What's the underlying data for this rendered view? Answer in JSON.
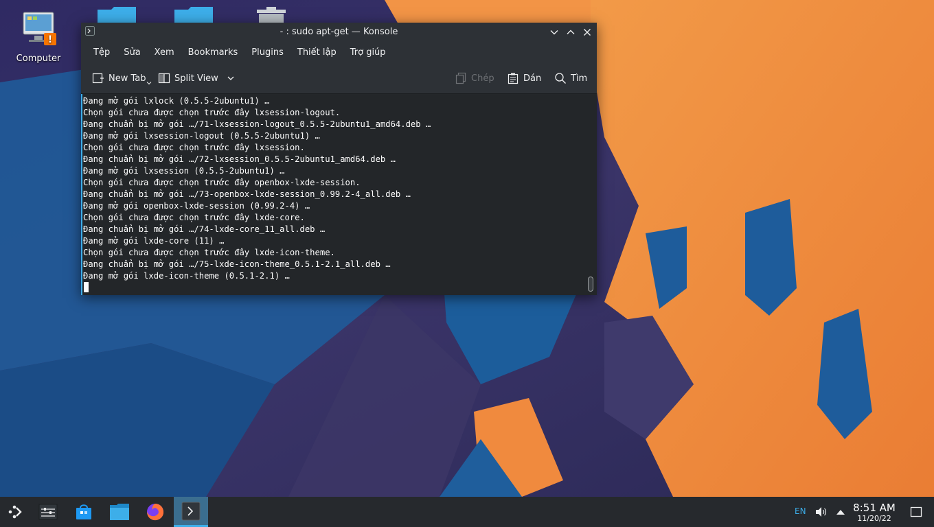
{
  "desktop": {
    "icons": [
      {
        "label": "Computer",
        "icon": "computer-icon"
      },
      {
        "label": "",
        "icon": "folder-icon"
      },
      {
        "label": "",
        "icon": "folder-icon"
      },
      {
        "label": "",
        "icon": "trash-icon"
      }
    ]
  },
  "window": {
    "title": "- : sudo apt-get — Konsole",
    "menu": [
      "Tệp",
      "Sửa",
      "Xem",
      "Bookmarks",
      "Plugins",
      "Thiết lập",
      "Trợ giúp"
    ],
    "toolbar": {
      "new_tab": "New Tab",
      "split_view": "Split View",
      "copy": "Chép",
      "paste": "Dán",
      "find": "Tìm"
    }
  },
  "terminal": {
    "lines": [
      "Đang mở gói lxlock (0.5.5-2ubuntu1) …",
      "Chọn gói chưa được chọn trước đây lxsession-logout.",
      "Đang chuẩn bị mở gói …/71-lxsession-logout_0.5.5-2ubuntu1_amd64.deb …",
      "Đang mở gói lxsession-logout (0.5.5-2ubuntu1) …",
      "Chọn gói chưa được chọn trước đây lxsession.",
      "Đang chuẩn bị mở gói …/72-lxsession_0.5.5-2ubuntu1_amd64.deb …",
      "Đang mở gói lxsession (0.5.5-2ubuntu1) …",
      "Chọn gói chưa được chọn trước đây openbox-lxde-session.",
      "Đang chuẩn bị mở gói …/73-openbox-lxde-session_0.99.2-4_all.deb …",
      "Đang mở gói openbox-lxde-session (0.99.2-4) …",
      "Chọn gói chưa được chọn trước đây lxde-core.",
      "Đang chuẩn bị mở gói …/74-lxde-core_11_all.deb …",
      "Đang mở gói lxde-core (11) …",
      "Chọn gói chưa được chọn trước đây lxde-icon-theme.",
      "Đang chuẩn bị mở gói …/75-lxde-icon-theme_0.5.1-2.1_all.deb …",
      "Đang mở gói lxde-icon-theme (0.5.1-2.1) …"
    ]
  },
  "taskbar": {
    "apps": [
      "application-launcher-icon",
      "pager-icon",
      "discover-store-icon",
      "file-manager-icon",
      "firefox-icon",
      "konsole-icon"
    ],
    "tray": {
      "language": "EN",
      "volume_icon": "volume-icon",
      "expand_icon": "tray-expand-icon",
      "time": "8:51 AM",
      "date": "11/20/22",
      "show_desktop_icon": "show-desktop-icon"
    }
  },
  "colors": {
    "accent": "#3daee9",
    "terminal_bg": "#232629",
    "wallpaper_orange": "#f08a3e",
    "wallpaper_blue": "#1f5e9c"
  }
}
